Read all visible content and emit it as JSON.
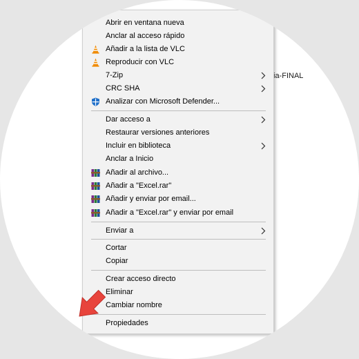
{
  "background": {
    "filename_fragment": "ia-FINAL"
  },
  "menu": {
    "items": [
      {
        "label": "Abrir en ventana nueva",
        "icon": "none"
      },
      {
        "label": "Anclar al acceso rápido",
        "icon": "none"
      },
      {
        "label": "Añadir a la lista de VLC",
        "icon": "vlc-cone-icon"
      },
      {
        "label": "Reproducir con VLC",
        "icon": "vlc-cone-icon"
      },
      {
        "label": "7-Zip",
        "icon": "none",
        "submenu": true
      },
      {
        "label": "CRC SHA",
        "icon": "none",
        "submenu": true
      },
      {
        "label": "Analizar con Microsoft Defender...",
        "icon": "defender-shield-icon"
      },
      {
        "label": "Dar acceso a",
        "icon": "none",
        "submenu": true
      },
      {
        "label": "Restaurar versiones anteriores",
        "icon": "none"
      },
      {
        "label": "Incluir en biblioteca",
        "icon": "none",
        "submenu": true
      },
      {
        "label": "Anclar a Inicio",
        "icon": "none"
      },
      {
        "label": "Añadir al archivo...",
        "icon": "winrar-books-icon"
      },
      {
        "label": "Añadir a \"Excel.rar\"",
        "icon": "winrar-books-icon"
      },
      {
        "label": "Añadir y enviar por email...",
        "icon": "winrar-books-icon"
      },
      {
        "label": "Añadir a \"Excel.rar\" y enviar por email",
        "icon": "winrar-books-icon"
      },
      {
        "label": "Enviar a",
        "icon": "none",
        "submenu": true
      },
      {
        "label": "Cortar",
        "icon": "none"
      },
      {
        "label": "Copiar",
        "icon": "none"
      },
      {
        "label": "Crear acceso directo",
        "icon": "none"
      },
      {
        "label": "Eliminar",
        "icon": "none"
      },
      {
        "label": "Cambiar nombre",
        "icon": "none"
      },
      {
        "label": "Propiedades",
        "icon": "none"
      }
    ]
  },
  "colors": {
    "pointer_arrow": "#e8443c",
    "menu_bg": "#f2f2f2"
  }
}
